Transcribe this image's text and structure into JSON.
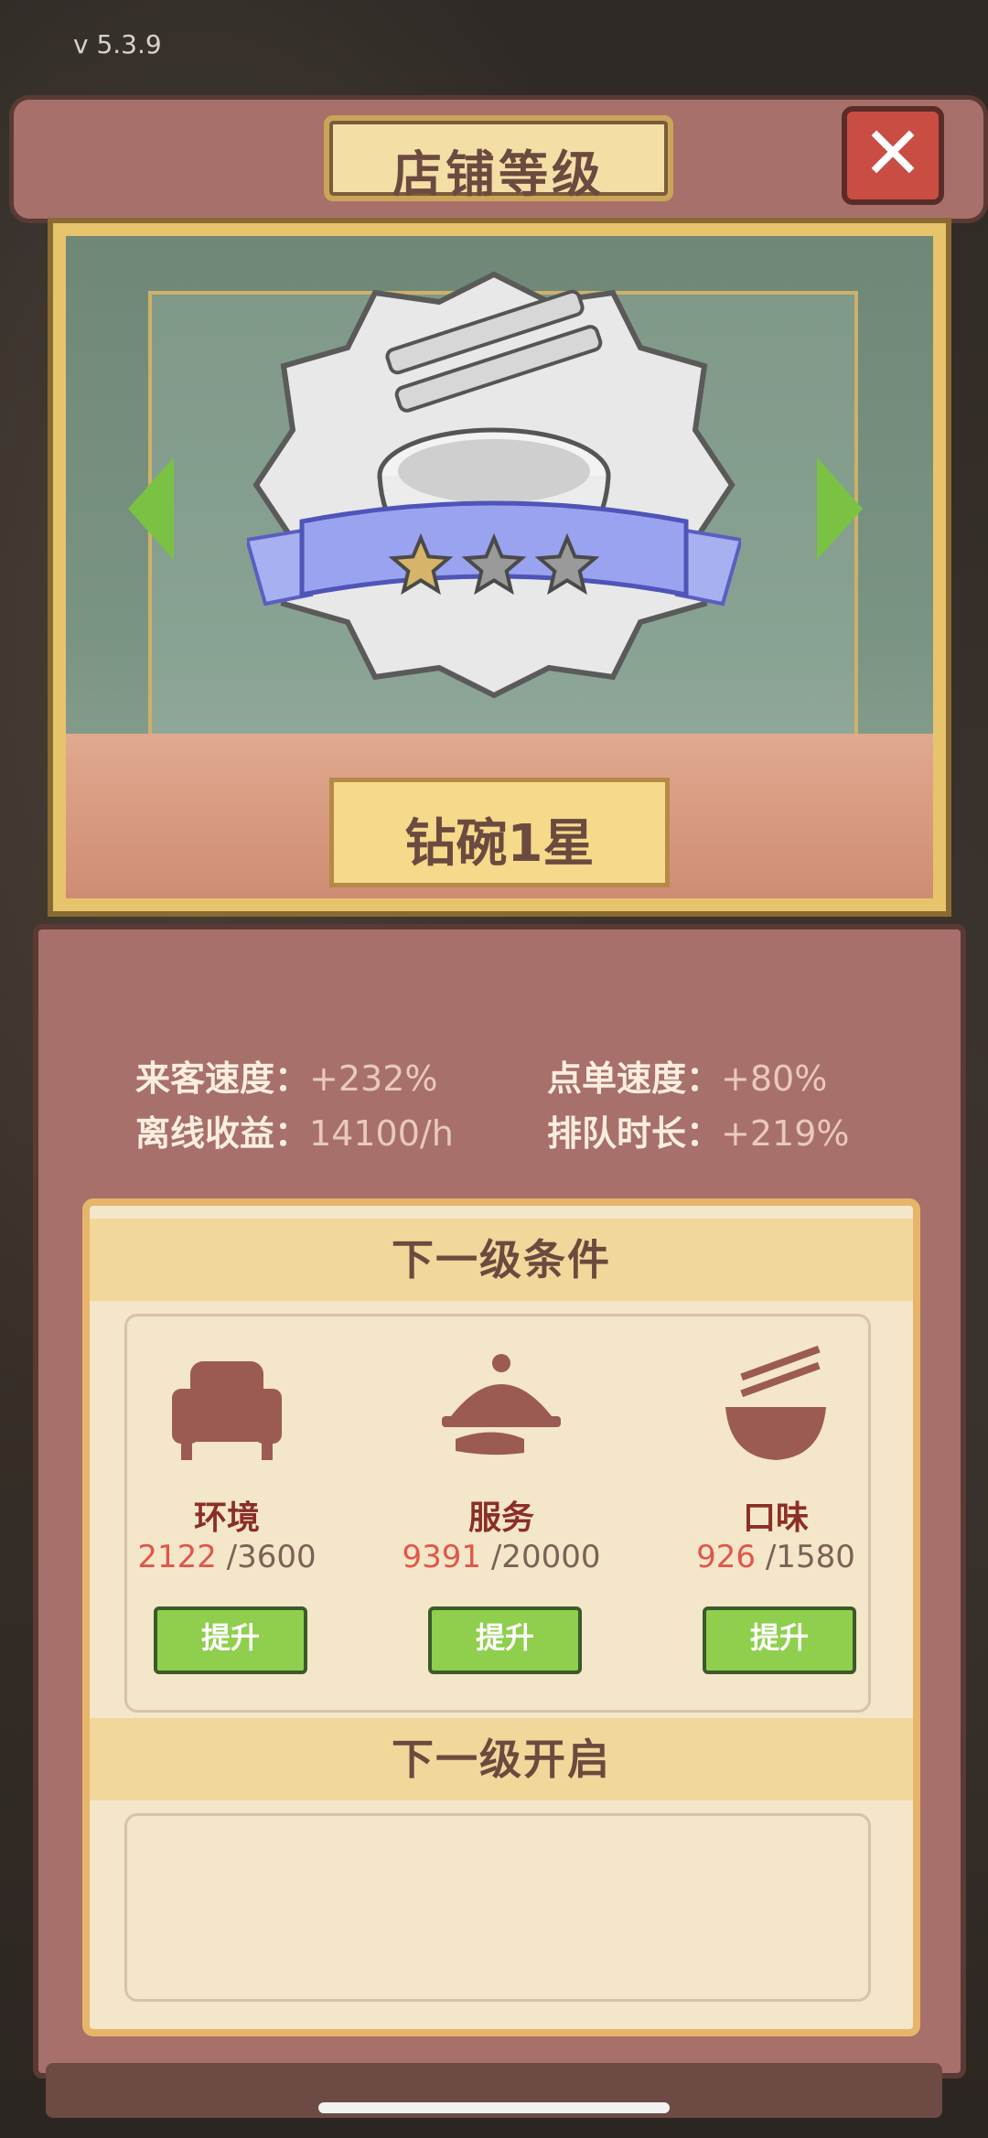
{
  "version": "v 5.3.9",
  "title": "店铺等级",
  "close_icon": "close-x-icon",
  "level_name": "钻碗1星",
  "stars": {
    "filled": 1,
    "total": 3
  },
  "stats": [
    {
      "label": "来客速度：",
      "value": "+232%"
    },
    {
      "label": "点单速度：",
      "value": "+80%"
    },
    {
      "label": "离线收益：",
      "value": "14100/h"
    },
    {
      "label": "排队时长：",
      "value": "+219%"
    }
  ],
  "conditions_title": "下一级条件",
  "requirements": [
    {
      "name": "环境",
      "current": "2122",
      "target": " /3600",
      "button": "提升",
      "icon": "armchair-icon"
    },
    {
      "name": "服务",
      "current": "9391",
      "target": " /20000",
      "button": "提升",
      "icon": "cloche-icon"
    },
    {
      "name": "口味",
      "current": "926",
      "target": " /1580",
      "button": "提升",
      "icon": "noodle-bowl-icon"
    }
  ],
  "unlock_title": "下一级开启",
  "colors": {
    "frame": "#a8706a",
    "accent_green": "#8fcf4d",
    "current_value": "#e0574b"
  }
}
